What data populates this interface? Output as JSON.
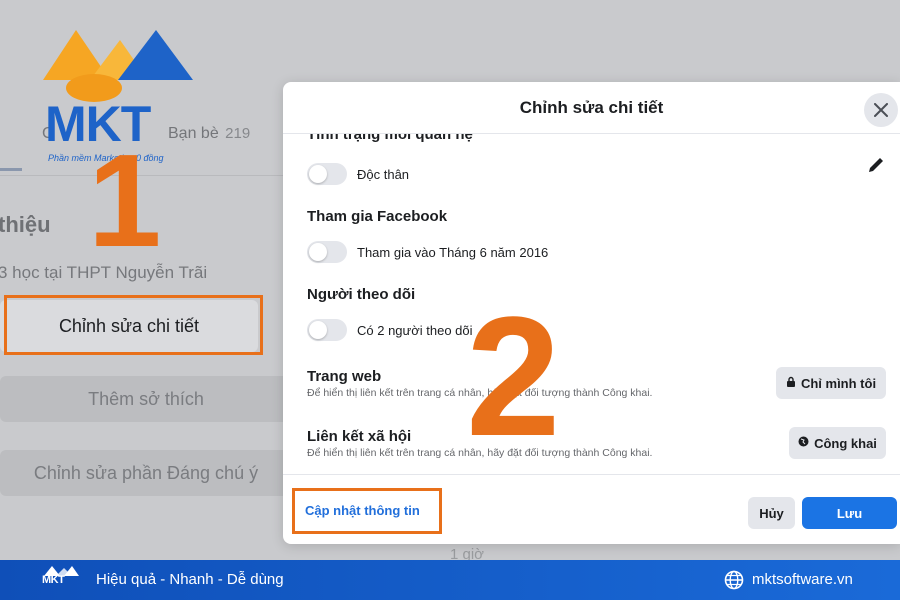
{
  "background": {
    "tabs": [
      {
        "label": "C"
      },
      {
        "label": "Bạn bè",
        "count": "219"
      }
    ],
    "heading": "thiệu",
    "school_line": "3 học tại THPT Nguyễn Trãi",
    "buttons": {
      "edit_details": "Chỉnh sửa chi tiết",
      "add_hobbies": "Thêm sở thích",
      "edit_featured": "Chỉnh sửa phần Đáng chú ý"
    },
    "bottom_text": "1 giờ"
  },
  "logo": {
    "text": "MKT",
    "subtitle": "Phần mềm Marketing 0 đồng"
  },
  "annotations": {
    "step1": "1",
    "step2": "2",
    "color": "#e8701a"
  },
  "modal": {
    "title": "Chỉnh sửa chi tiết",
    "sections": {
      "relationship": {
        "title": "Tình trạng mối quan hệ",
        "toggle_label": "Độc thân",
        "enabled": false
      },
      "joined": {
        "title": "Tham gia Facebook",
        "toggle_label": "Tham gia vào Tháng 6 năm 2016",
        "enabled": false
      },
      "followers": {
        "title": "Người theo dõi",
        "toggle_label": "Có 2 người theo dõi",
        "enabled": false
      },
      "website": {
        "title": "Trang web",
        "description": "Để hiển thị liên kết trên trang cá nhân, hãy đặt đối tượng thành Công khai.",
        "privacy_label": "Chỉ mình tôi",
        "privacy_icon": "lock-icon"
      },
      "social": {
        "title": "Liên kết xã hội",
        "description": "Để hiển thị liên kết trên trang cá nhân, hãy đặt đối tượng thành Công khai.",
        "privacy_label": "Công khai",
        "privacy_icon": "globe-icon"
      }
    },
    "footer": {
      "update_link": "Cập nhật thông tin",
      "cancel_label": "Hủy",
      "save_label": "Lưu"
    },
    "accent_color": "#1b74e4"
  },
  "banner": {
    "logo_text": "MKT",
    "slogan": "Hiệu quả - Nhanh - Dễ dùng",
    "site": "mktsoftware.vn"
  }
}
